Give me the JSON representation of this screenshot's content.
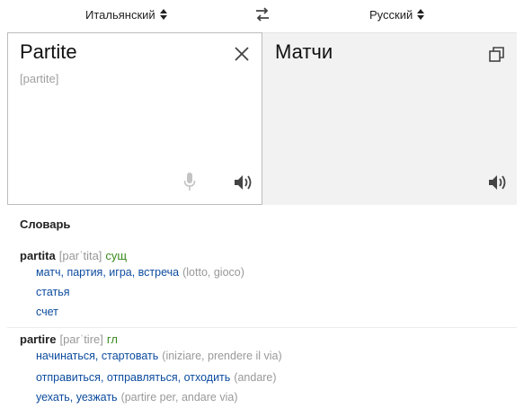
{
  "languages": {
    "source": "Итальянский",
    "target": "Русский"
  },
  "source": {
    "text": "Partite",
    "transliteration": "[partite]"
  },
  "target": {
    "text": "Матчи"
  },
  "icons": {
    "swap": "swap-arrows-icon",
    "close": "close-icon",
    "mic": "microphone-icon",
    "speaker": "speaker-icon",
    "copy": "copy-icon",
    "sort": "sort-arrows-icon"
  },
  "colors": {
    "translation_link": "#0b4b9e",
    "part_of_speech": "#3a8a1e",
    "muted": "#999999",
    "target_bg": "#f2f2f2"
  },
  "dictionary": {
    "title": "Словарь",
    "entries": [
      {
        "word": "partita",
        "transcription": "[parˈtita]",
        "pos": "сущ",
        "senses": [
          {
            "translation": "матч, партия, игра, встреча",
            "gloss": "(lotto, gioco)"
          },
          {
            "translation": "статья",
            "gloss": ""
          },
          {
            "translation": "счет",
            "gloss": ""
          }
        ]
      },
      {
        "word": "partire",
        "transcription": "[parˈtire]",
        "pos": "гл",
        "senses": [
          {
            "translation": "начинаться, стартовать",
            "gloss": "(iniziare, prendere il via)"
          },
          {
            "translation": "отправиться, отправляться, отходить",
            "gloss": "(andare)"
          },
          {
            "translation": "уехать, уезжать",
            "gloss": "(partire per, andare via)"
          }
        ]
      }
    ]
  }
}
